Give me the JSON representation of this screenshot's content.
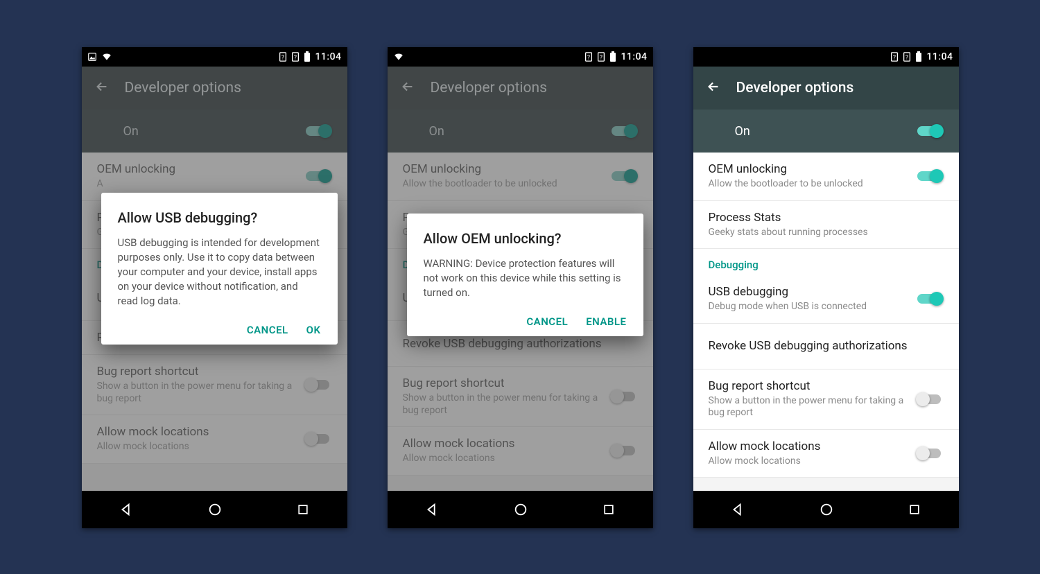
{
  "statusbar": {
    "time": "11:04"
  },
  "appbar": {
    "title": "Developer options"
  },
  "onrow": {
    "label": "On"
  },
  "items": {
    "oem": {
      "title": "OEM unlocking",
      "sub": "Allow the bootloader to be unlocked"
    },
    "process": {
      "title": "Process Stats",
      "sub": "Geeky stats about running processes"
    },
    "debugging_header": "Debugging",
    "usb": {
      "title": "USB debugging",
      "sub": "Debug mode when USB is connected"
    },
    "revoke": {
      "title": "Revoke USB debugging authorizations"
    },
    "bugreport": {
      "title": "Bug report shortcut",
      "sub": "Show a button in the power menu for taking a bug report"
    },
    "mock": {
      "title": "Allow mock locations",
      "sub": "Allow mock locations"
    },
    "p_partial": {
      "title": "P",
      "sub": "G"
    },
    "d_partial": "D",
    "u_partial": "U",
    "r_partial": "R"
  },
  "dialog_usb": {
    "title": "Allow USB debugging?",
    "body": "USB debugging is intended for development purposes only. Use it to copy data between your computer and your device, install apps on your device without notification, and read log data.",
    "cancel": "CANCEL",
    "ok": "OK"
  },
  "dialog_oem": {
    "title": "Allow OEM unlocking?",
    "body": "WARNING: Device protection features will not work on this device while this setting is turned on.",
    "cancel": "CANCEL",
    "enable": "ENABLE"
  }
}
